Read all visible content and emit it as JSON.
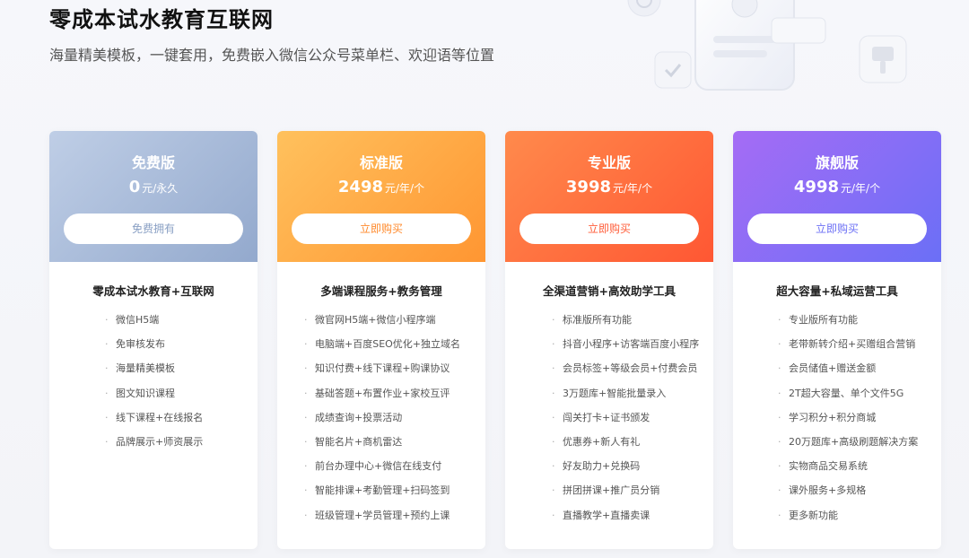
{
  "hero": {
    "title": "零成本试水教育互联网",
    "subtitle": "海量精美模板，一键套用，免费嵌入微信公众号菜单栏、欢迎语等位置"
  },
  "colors": {
    "free": "#93a9cd",
    "standard": "#ff9632",
    "pro": "#ff5733",
    "flagship": "#6b6ff6"
  },
  "plans": [
    {
      "name": "免费版",
      "price": "0",
      "unit": "元/永久",
      "button": "免费拥有",
      "headline": "零成本试水教育+互联网",
      "features": [
        "微信H5端",
        "免审核发布",
        "海量精美模板",
        "图文知识课程",
        "线下课程+在线报名",
        "品牌展示+师资展示"
      ]
    },
    {
      "name": "标准版",
      "price": "2498",
      "unit": "元/年/个",
      "button": "立即购买",
      "headline": "多端课程服务+教务管理",
      "features": [
        "微官网H5端+微信小程序端",
        "电脑端+百度SEO优化+独立域名",
        "知识付费+线下课程+购课协议",
        "基础答题+布置作业+家校互评",
        "成绩查询+投票活动",
        "智能名片+商机雷达",
        "前台办理中心+微信在线支付",
        "智能排课+考勤管理+扫码签到",
        "班级管理+学员管理+预约上课"
      ]
    },
    {
      "name": "专业版",
      "price": "3998",
      "unit": "元/年/个",
      "button": "立即购买",
      "headline": "全渠道营销+高效助学工具",
      "features": [
        "标准版所有功能",
        "抖音小程序+访客端百度小程序",
        "会员标签+等级会员+付费会员",
        "3万题库+智能批量录入",
        "闯关打卡+证书颁发",
        "优惠券+新人有礼",
        "好友助力+兑换码",
        "拼团拼课+推广员分销",
        "直播教学+直播卖课"
      ]
    },
    {
      "name": "旗舰版",
      "price": "4998",
      "unit": "元/年/个",
      "button": "立即购买",
      "headline": "超大容量+私域运营工具",
      "features": [
        "专业版所有功能",
        "老带新转介绍+买赠组合营销",
        "会员储值+赠送金额",
        "2T超大容量、单个文件5G",
        "学习积分+积分商城",
        "20万题库+高级刷题解决方案",
        "实物商品交易系统",
        "课外服务+多规格",
        "更多新功能"
      ]
    }
  ]
}
